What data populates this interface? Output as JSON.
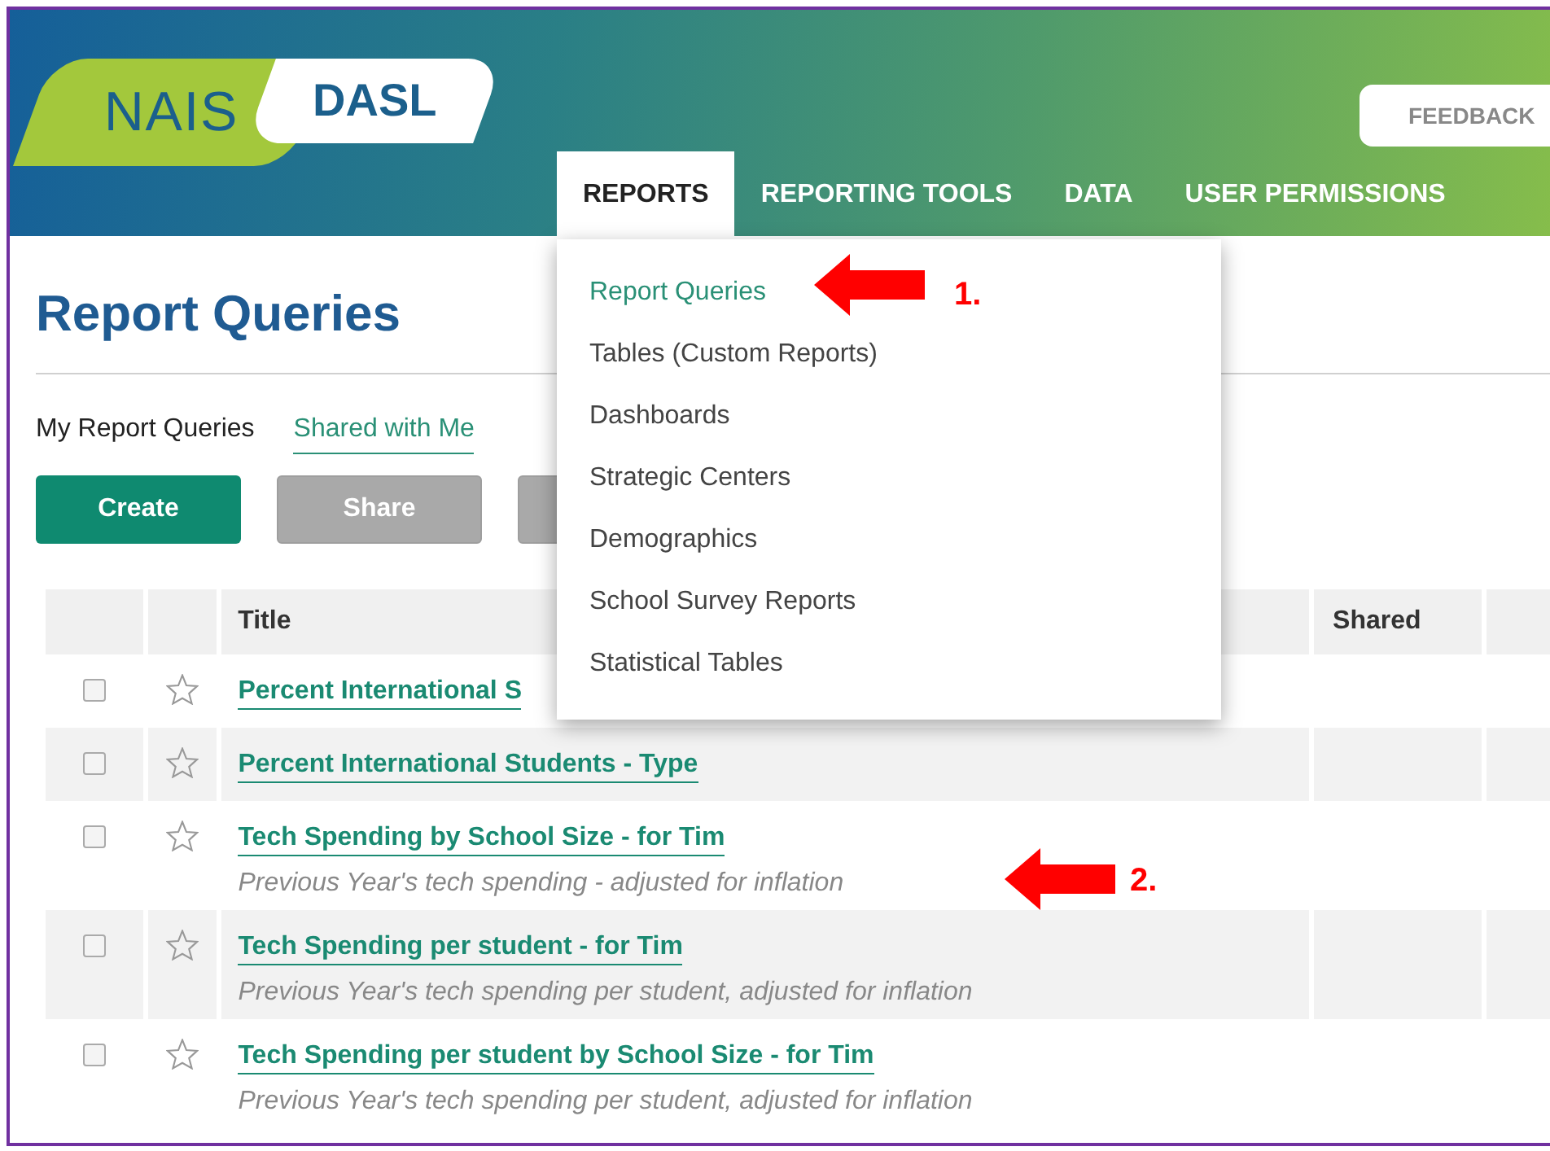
{
  "header": {
    "logo": {
      "left": "NAIS",
      "right": "DASL"
    },
    "feedback": "FEEDBACK",
    "nav": [
      {
        "label": "REPORTS",
        "selected": true
      },
      {
        "label": "REPORTING TOOLS",
        "selected": false
      },
      {
        "label": "DATA",
        "selected": false
      },
      {
        "label": "USER PERMISSIONS",
        "selected": false
      }
    ]
  },
  "page_title": "Report Queries",
  "view_tabs": [
    {
      "label": "My Report Queries",
      "selected": true
    },
    {
      "label": "Shared with Me",
      "selected": false
    }
  ],
  "buttons": [
    {
      "label": "Create",
      "disabled": false
    },
    {
      "label": "Share",
      "disabled": true
    },
    {
      "disabled": true
    }
  ],
  "table": {
    "columns": [
      "Title",
      "Shared"
    ],
    "rows": [
      {
        "checked": false,
        "starred": false,
        "title": "Percent International S"
      },
      {
        "checked": false,
        "starred": false,
        "title": "Percent International Students - Type"
      },
      {
        "checked": false,
        "starred": false,
        "title": "Tech Spending by School Size - for Tim",
        "description": "Previous Year's tech spending - adjusted for inflation"
      },
      {
        "checked": false,
        "starred": false,
        "title": "Tech Spending per student - for Tim",
        "description": "Previous Year's tech spending per student, adjusted for inflation"
      },
      {
        "checked": false,
        "starred": false,
        "title": "Tech Spending per student by School Size - for Tim",
        "description": "Previous Year's tech spending per student, adjusted for inflation"
      }
    ]
  },
  "dropdown": {
    "items": [
      {
        "label": "Report Queries",
        "selected": true
      },
      {
        "label": "Tables (Custom Reports)",
        "selected": false
      },
      {
        "label": "Dashboards",
        "selected": false
      },
      {
        "label": "Strategic Centers",
        "selected": false
      },
      {
        "label": "Demographics",
        "selected": false
      },
      {
        "label": "School Survey Reports",
        "selected": false
      },
      {
        "label": "Statistical Tables",
        "selected": false
      }
    ]
  },
  "annotations": [
    {
      "label": "1."
    },
    {
      "label": "2."
    }
  ]
}
